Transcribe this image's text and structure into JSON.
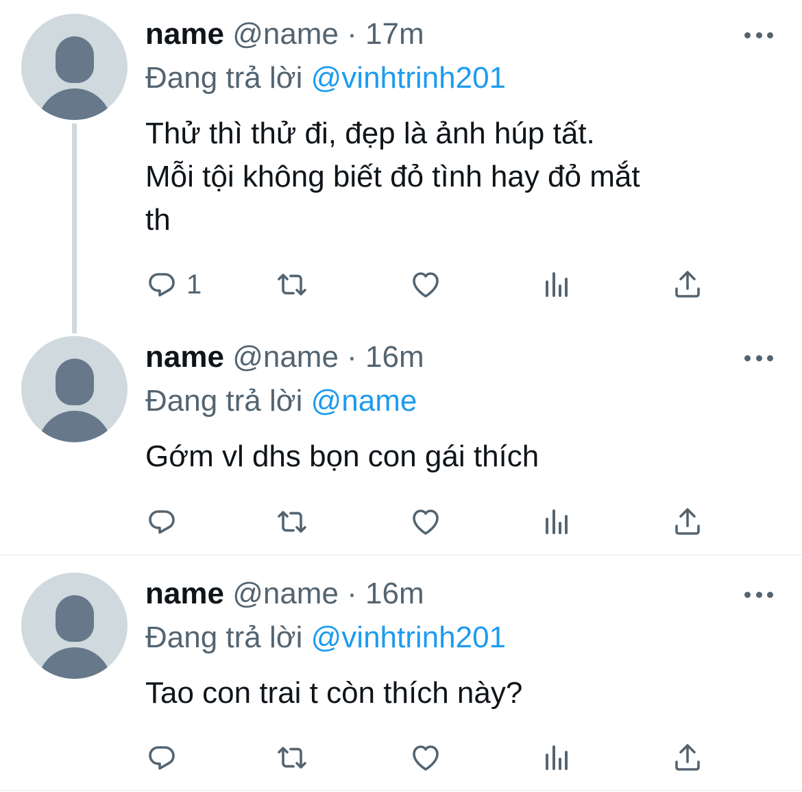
{
  "tweets": [
    {
      "name": "name",
      "handle": "@name",
      "separator": "·",
      "time": "17m",
      "replying_prefix": "Đang trả lời",
      "mention": "@vinhtrinh201",
      "text_lines": [
        "Thử thì thử đi, đẹp là ảnh húp tất.",
        "Mỗi tội không biết đỏ tình hay đỏ mắt",
        "th"
      ],
      "reply_count": "1"
    },
    {
      "name": "name",
      "handle": "@name",
      "separator": "·",
      "time": "16m",
      "replying_prefix": "Đang trả lời",
      "mention": "@name",
      "text_lines": [
        "Gớm vl dhs bọn con gái thích"
      ],
      "reply_count": ""
    },
    {
      "name": "name",
      "handle": "@name",
      "separator": "·",
      "time": "16m",
      "replying_prefix": "Đang trả lời",
      "mention": "@vinhtrinh201",
      "text_lines": [
        "Tao con trai t còn thích này?"
      ],
      "reply_count": ""
    }
  ],
  "icons": {
    "reply": "reply-icon",
    "retweet": "retweet-icon",
    "like": "heart-icon",
    "views": "analytics-icon",
    "share": "share-icon",
    "more": "more-icon"
  },
  "colors": {
    "text": "#0f1419",
    "muted": "#536471",
    "mention": "#1d9bf0",
    "avatar_bg": "#cfd9de",
    "avatar_fg": "#66788a",
    "divider": "#eff3f4"
  }
}
